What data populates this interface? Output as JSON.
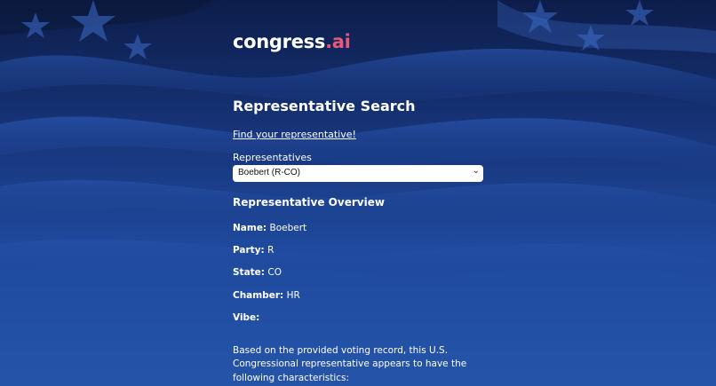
{
  "brand": {
    "name": "congress",
    "suffix": ".ai"
  },
  "page_title": "Representative Search",
  "find_link": "Find your representative!",
  "select": {
    "label": "Representatives",
    "value": "Boebert (R-CO)"
  },
  "overview": {
    "title": "Representative Overview",
    "fields": [
      {
        "label": "Name:",
        "value": "Boebert"
      },
      {
        "label": "Party:",
        "value": "R"
      },
      {
        "label": "State:",
        "value": "CO"
      },
      {
        "label": "Chamber:",
        "value": "HR"
      },
      {
        "label": "Vibe:",
        "value": ""
      }
    ],
    "description": "Based on the provided voting record, this U.S. Congressional representative appears to have the following characteristics:"
  },
  "colors": {
    "accent": "#e8587a",
    "background": "#1f4a9e"
  },
  "icons": [
    "chevron-updown-icon",
    "star-icon"
  ]
}
